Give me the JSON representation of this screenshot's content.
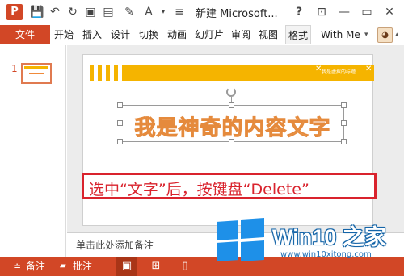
{
  "title_bar": {
    "app_logo": "P",
    "quick_access": [
      {
        "icon": "save-icon",
        "glyph": "💾"
      },
      {
        "icon": "undo-icon",
        "glyph": "↶"
      },
      {
        "icon": "redo-icon",
        "glyph": "↻"
      },
      {
        "icon": "from-start-icon",
        "glyph": "▣"
      },
      {
        "icon": "new-slide-icon",
        "glyph": "▤"
      },
      {
        "icon": "format-painter-icon",
        "glyph": "✎"
      },
      {
        "icon": "font-color-icon",
        "glyph": "A"
      },
      {
        "icon": "more-icon",
        "glyph": "▾"
      },
      {
        "icon": "customize-icon",
        "glyph": "≡"
      }
    ],
    "document_title": "新建 Microsoft...",
    "controls": [
      {
        "icon": "help-icon",
        "glyph": "?"
      },
      {
        "icon": "ribbon-display-icon",
        "glyph": "⊡"
      },
      {
        "icon": "minimize-icon",
        "glyph": "—"
      },
      {
        "icon": "restore-icon",
        "glyph": "▭"
      },
      {
        "icon": "close-icon",
        "glyph": "✕"
      }
    ]
  },
  "ribbon": {
    "file_tab": "文件",
    "tabs": [
      "开始",
      "插入",
      "设计",
      "切换",
      "动画",
      "幻灯片",
      "审阅",
      "视图",
      "格式"
    ],
    "active_tab": "格式",
    "user_name": "With Me",
    "user_caret": "▾",
    "collapse_glyph": "▴",
    "avatar_glyph": "◕"
  },
  "thumbnails": {
    "slide_number": "1"
  },
  "slide": {
    "band_text": "我是虚拟的标题",
    "band_close_glyph": "✕",
    "main_text": "我是神奇的内容文字",
    "instruction": "选中“文字”后，按键盘“Delete”"
  },
  "notes": {
    "placeholder": "单击此处添加备注"
  },
  "status_bar": {
    "notes_label": "备注",
    "notes_icon": "≐",
    "comments_label": "批注",
    "comments_icon": "▰",
    "view_icons": [
      {
        "icon": "normal-view-icon",
        "glyph": "▣",
        "active": true
      },
      {
        "icon": "slide-sorter-icon",
        "glyph": "⊞",
        "active": false
      },
      {
        "icon": "reading-view-icon",
        "glyph": "▯",
        "active": false
      }
    ]
  },
  "watermark": {
    "title": "Win10 之家",
    "url": "www.win10xitong.com"
  },
  "colors": {
    "accent": "#d24726",
    "band": "#f5b400",
    "instruction_red": "#d9232d",
    "text_orange": "#e58a3c"
  }
}
